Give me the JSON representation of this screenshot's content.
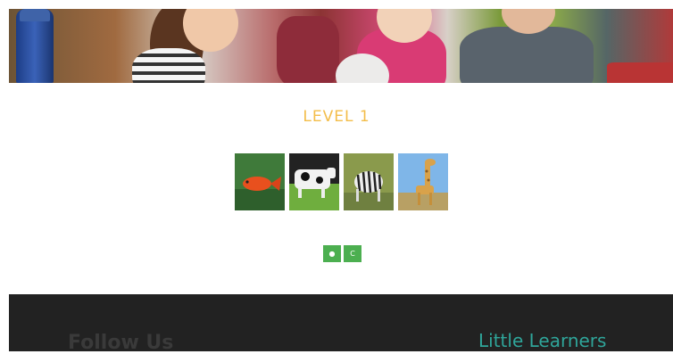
{
  "level": {
    "title": "LEVEL 1"
  },
  "thumbnails": [
    {
      "icon": "fish-icon"
    },
    {
      "icon": "cow-icon"
    },
    {
      "icon": "zebra-icon"
    },
    {
      "icon": "giraffe-icon"
    }
  ],
  "controls": {
    "play_label": "●",
    "clear_label": "C"
  },
  "footer": {
    "follow_label": "Follow Us",
    "brand_label": "Little Learners"
  },
  "colors": {
    "title": "#f3bd4a",
    "button": "#4caf50",
    "footer_bg": "#222222",
    "brand": "#2fa59a"
  }
}
